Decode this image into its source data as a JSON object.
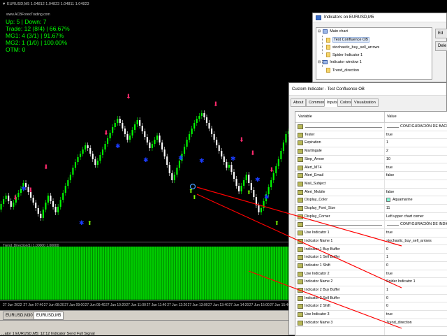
{
  "chart": {
    "symbol_header": "▼ EURUSD,M5  1.04812 1.04823 1.04811 1.04823",
    "site_label": "www.ACBForexTrading.com",
    "stats": [
      "Up: 5 | Down: 7",
      "Trade: 12 (8/4) | 66.67%",
      "MG1:  4 (3/1) | 91.67%",
      "MG2:  1 (1/0) | 100.00%",
      "OTM:  0"
    ],
    "indicator_window_title": "Trend_Direction(1) 1.00000 1.00000",
    "time_labels": [
      "27 Jun 2022",
      "27 Jun 07:40",
      "27 Jun 08:20",
      "27 Jun 09:00",
      "27 Jun 09:40",
      "27 Jun 10:20",
      "27 Jun 11:00",
      "27 Jun 11:40",
      "27 Jun 12:20",
      "27 Jun 13:00",
      "27 Jun 13:40",
      "27 Jun 14:20",
      "27 Jun 15:00",
      "27 Jun 15:40"
    ],
    "tabs": [
      "EURUSD,M30",
      "EURUSD,M5"
    ],
    "active_tab": "EURUSD,M5",
    "status_text": "...ator 1 EURUSD,M5: 12:12  Indicator Send Full Signal",
    "colors": {
      "bull": "#00ff00",
      "bear": "#ffffff",
      "up_arrow": "#7cfc00",
      "down_arrow": "#ff2a6d",
      "dot": "#1a3cff",
      "link": "#ff0000"
    }
  },
  "indicators_window": {
    "title": "Indicators on EURUSD,M5",
    "tree": [
      {
        "label": "Main chart",
        "kind": "chart"
      },
      {
        "label": "Test Confluence OB",
        "kind": "indicator",
        "selected": true
      },
      {
        "label": "stochastic_buy_sell_arrows",
        "kind": "indicator"
      },
      {
        "label": "Spider Indicator 1",
        "kind": "indicator"
      },
      {
        "label": "Indicator window 1",
        "kind": "chart"
      },
      {
        "label": "Trend_direction",
        "kind": "indicator"
      }
    ],
    "buttons": [
      "Ed",
      "Dele"
    ]
  },
  "custom_indicator": {
    "title": "Custom Indicator - Test Confluence OB",
    "tabs": [
      "About",
      "Common",
      "Inputs",
      "Colors",
      "Visualization"
    ],
    "active_tab": "Inputs",
    "columns": {
      "variable": "Variable",
      "value": "Value"
    },
    "rows": [
      {
        "name": "",
        "value": "CONFIGURACIÓN DE BACK",
        "section": true
      },
      {
        "name": "Tester",
        "value": "true"
      },
      {
        "name": "Expiration",
        "value": "1"
      },
      {
        "name": "Martingale",
        "value": "2"
      },
      {
        "name": "Step_Arrow",
        "value": "10"
      },
      {
        "name": "Alert_MT4",
        "value": "true"
      },
      {
        "name": "Alert_Email",
        "value": "false"
      },
      {
        "name": "Mail_Subject",
        "value": ""
      },
      {
        "name": "Alert_Mobile",
        "value": "false"
      },
      {
        "name": "Display_Color",
        "value": "Aquamarine",
        "swatch": "#7fffd4"
      },
      {
        "name": "Display_Font_Size",
        "value": "11"
      },
      {
        "name": "Display_Corner",
        "value": "Left upper chart corner"
      },
      {
        "name": "",
        "value": "CONFIGURACIÓN DE INDIC",
        "section": true
      },
      {
        "name": "Use Indicator 1",
        "value": "true"
      },
      {
        "name": "Indicator Name 1",
        "value": "stochastic_buy_sell_arrows"
      },
      {
        "name": "Indicator 1 Buy Buffer",
        "value": "0"
      },
      {
        "name": "Indicator 1 Sell Buffer",
        "value": "1"
      },
      {
        "name": "Indicator 1 Shift",
        "value": "0"
      },
      {
        "name": "Use Indicator 2",
        "value": "true"
      },
      {
        "name": "Indicator Name 2",
        "value": "Spider Indicator 1"
      },
      {
        "name": "Indicator 2 Buy Buffer",
        "value": "1"
      },
      {
        "name": "Indicator 2 Sell Buffer",
        "value": "0"
      },
      {
        "name": "Indicator 2 Shift",
        "value": "0"
      },
      {
        "name": "Use Indicator 3",
        "value": "true"
      },
      {
        "name": "Indicator Name 3",
        "value": "Trend_direction"
      }
    ]
  }
}
